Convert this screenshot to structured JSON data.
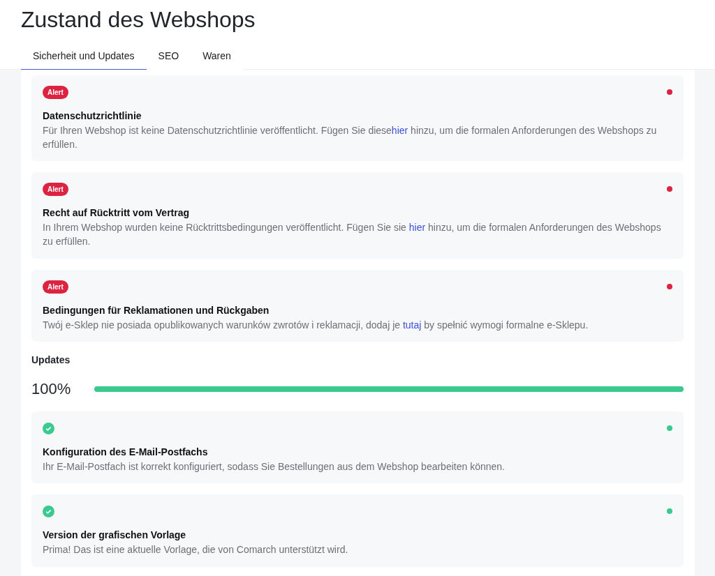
{
  "page_title": "Zustand des Webshops",
  "tabs": [
    {
      "label": "Sicherheit und Updates",
      "selected": true
    },
    {
      "label": "SEO",
      "selected": false
    },
    {
      "label": "Waren",
      "selected": false
    }
  ],
  "alerts": [
    {
      "kind": "alert",
      "badge": "Alert",
      "color": "#dc2342",
      "title": "Datenschutzrichtlinie",
      "text_before": "Für Ihren Webshop ist keine Datenschutzrichtlinie veröffentlicht. Fügen Sie diese",
      "link": "hier",
      "text_after": " hinzu, um die formalen Anforderungen des Webshops zu erfüllen."
    },
    {
      "kind": "alert",
      "badge": "Alert",
      "color": "#dc2342",
      "title": "Recht auf Rücktritt vom Vertrag",
      "text_before": "In Ihrem Webshop wurden keine Rücktrittsbedingungen veröffentlicht. Fügen Sie sie ",
      "link": "hier",
      "text_after": " hinzu, um die formalen Anforderungen des Webshops zu erfüllen."
    },
    {
      "kind": "alert",
      "badge": "Alert",
      "color": "#dc2342",
      "title": "Bedingungen für Reklamationen und Rückgaben",
      "text_before": "Twój e-Sklep nie posiada opublikowanych warunków zwrotów i reklamacji, dodaj je ",
      "link": "tutaj",
      "text_after": " by spełnić wymogi formalne e-Sklepu."
    }
  ],
  "updates": {
    "heading": "Updates",
    "reading": "100%",
    "level": 1,
    "items": [
      {
        "kind": "ok",
        "color": "#3ac98f",
        "title": "Konfiguration des E-Mail-Postfachs",
        "text_before": "Ihr E-Mail-Postfach ist korrekt konfiguriert, sodass Sie Bestellungen aus dem Webshop bearbeiten können."
      },
      {
        "kind": "ok",
        "color": "#3ac98f",
        "title": "Version der grafischen Vorlage",
        "text_before": "Prima! Das ist eine aktuelle Vorlage, die von Comarch unterstützt wird."
      }
    ]
  }
}
